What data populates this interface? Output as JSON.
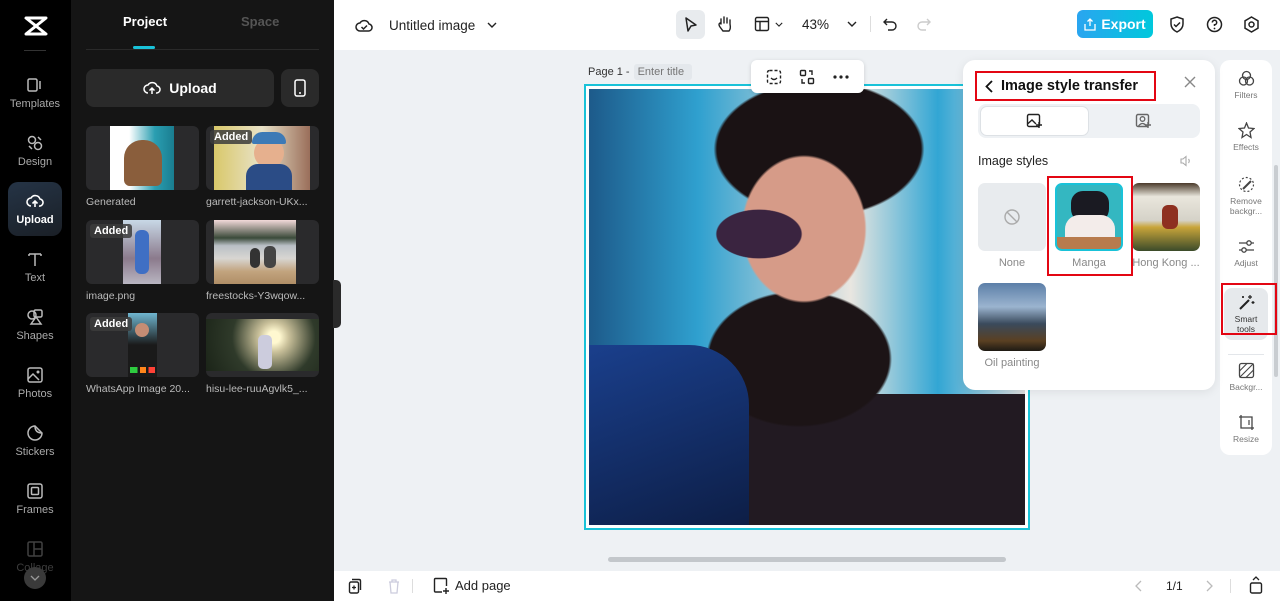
{
  "app": {
    "logo": "capcut-logo"
  },
  "rail": {
    "items": [
      {
        "label": "Templates",
        "icon": "templates-icon"
      },
      {
        "label": "Design",
        "icon": "design-icon"
      },
      {
        "label": "Upload",
        "icon": "upload-cloud-icon",
        "active": true
      },
      {
        "label": "Text",
        "icon": "text-icon"
      },
      {
        "label": "Shapes",
        "icon": "shapes-icon"
      },
      {
        "label": "Photos",
        "icon": "photos-icon"
      },
      {
        "label": "Stickers",
        "icon": "stickers-icon"
      },
      {
        "label": "Frames",
        "icon": "frames-icon"
      },
      {
        "label": "Collage",
        "icon": "collage-icon"
      }
    ]
  },
  "panel": {
    "tabs": [
      "Project",
      "Space"
    ],
    "active_tab": "Project",
    "upload_label": "Upload",
    "assets": [
      {
        "name": "Generated",
        "badge": ""
      },
      {
        "name": "garrett-jackson-UKx...",
        "badge": "Added"
      },
      {
        "name": "image.png",
        "badge": "Added"
      },
      {
        "name": "freestocks-Y3wqow...",
        "badge": ""
      },
      {
        "name": "WhatsApp Image 20...",
        "badge": "Added"
      },
      {
        "name": "hisu-lee-ruuAgvlk5_...",
        "badge": ""
      }
    ]
  },
  "topbar": {
    "doc_title": "Untitled image",
    "zoom": "43%",
    "export_label": "Export"
  },
  "canvas": {
    "page_label": "Page 1 -",
    "title_placeholder": "Enter title"
  },
  "style_panel": {
    "title": "Image style transfer",
    "section": "Image styles",
    "styles": [
      {
        "label": "None"
      },
      {
        "label": "Manga",
        "selected": true
      },
      {
        "label": "Hong Kong ..."
      },
      {
        "label": "Oil painting"
      }
    ]
  },
  "tools": {
    "items": [
      {
        "label": "Filters"
      },
      {
        "label": "Effects"
      },
      {
        "label": "Remove backgr..."
      },
      {
        "label": "Adjust"
      },
      {
        "label": "Smart tools",
        "active": true
      },
      {
        "label": "Backgr..."
      },
      {
        "label": "Resize"
      }
    ]
  },
  "bottombar": {
    "add_page": "Add page",
    "page_counter": "1/1"
  },
  "colors": {
    "accent": "#19c2d8",
    "export_start": "#2aa5f0",
    "export_end": "#00c8dc",
    "highlight": "#e30613"
  }
}
